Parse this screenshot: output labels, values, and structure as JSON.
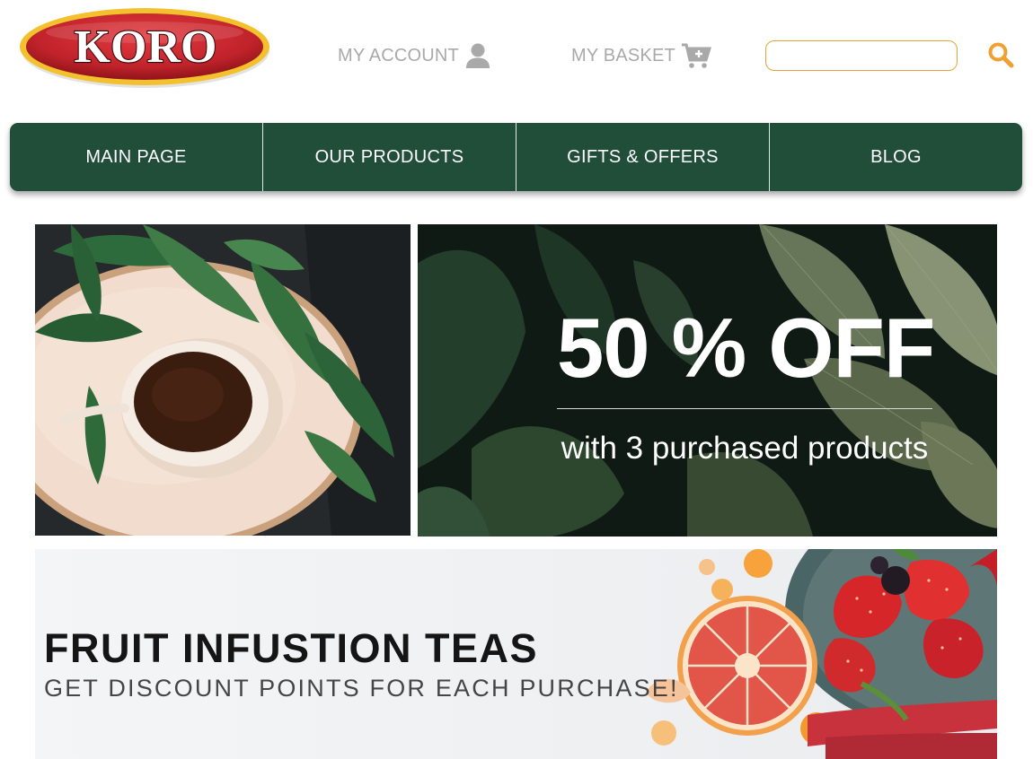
{
  "header": {
    "logo_text": "KORO",
    "account_label": "MY ACCOUNT",
    "basket_label": "MY BASKET",
    "search": {
      "value": "",
      "placeholder": ""
    }
  },
  "nav": {
    "items": [
      {
        "label": "MAIN PAGE"
      },
      {
        "label": "OUR PRODUCTS"
      },
      {
        "label": "GIFTS & OFFERS"
      },
      {
        "label": "BLOG"
      }
    ]
  },
  "promo": {
    "sale_title": "50 % OFF",
    "sale_subtitle": "with 3 purchased products"
  },
  "fruit_banner": {
    "title": "FRUIT INFUSTION TEAS",
    "subtitle": "GET DISCOUNT POINTS FOR EACH PURCHASE!"
  },
  "icons": {
    "account": "user-icon",
    "basket": "cart-plus-icon",
    "search": "search-icon"
  },
  "colors": {
    "nav_bg": "#214e38",
    "accent": "#e5a33a",
    "logo_red": "#c8252d",
    "logo_gold": "#f2c12e",
    "header_link": "#a9a9a9"
  }
}
